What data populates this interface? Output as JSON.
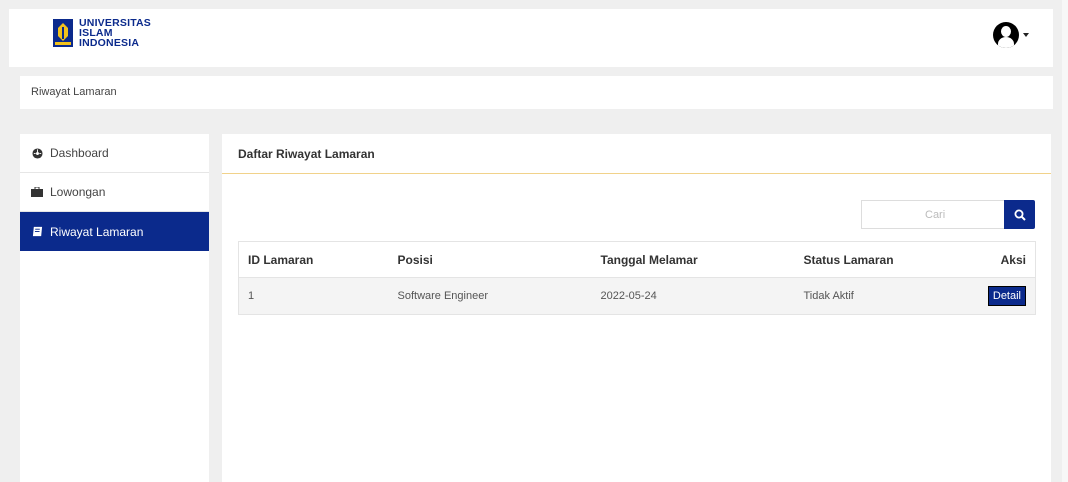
{
  "header": {
    "logo_lines": [
      "UNIVERSITAS",
      "ISLAM",
      "INDONESIA"
    ],
    "brand_color": "#0b2a8c",
    "user_icon": "user-circle-icon",
    "caret_icon": "caret-down-icon"
  },
  "breadcrumb": {
    "label": "Riwayat Lamaran"
  },
  "sidebar": {
    "items": [
      {
        "label": "Dashboard",
        "icon": "dashboard-icon",
        "active": false
      },
      {
        "label": "Lowongan",
        "icon": "briefcase-icon",
        "active": false
      },
      {
        "label": "Riwayat Lamaran",
        "icon": "book-icon",
        "active": true
      }
    ]
  },
  "main": {
    "title": "Daftar Riwayat Lamaran",
    "search": {
      "placeholder": "Cari",
      "value": ""
    },
    "table": {
      "columns": [
        "ID Lamaran",
        "Posisi",
        "Tanggal Melamar",
        "Status Lamaran",
        "Aksi"
      ],
      "rows": [
        {
          "id": "1",
          "posisi": "Software Engineer",
          "tanggal": "2022-05-24",
          "status": "Tidak Aktif",
          "aksi": "Detail"
        }
      ]
    }
  }
}
